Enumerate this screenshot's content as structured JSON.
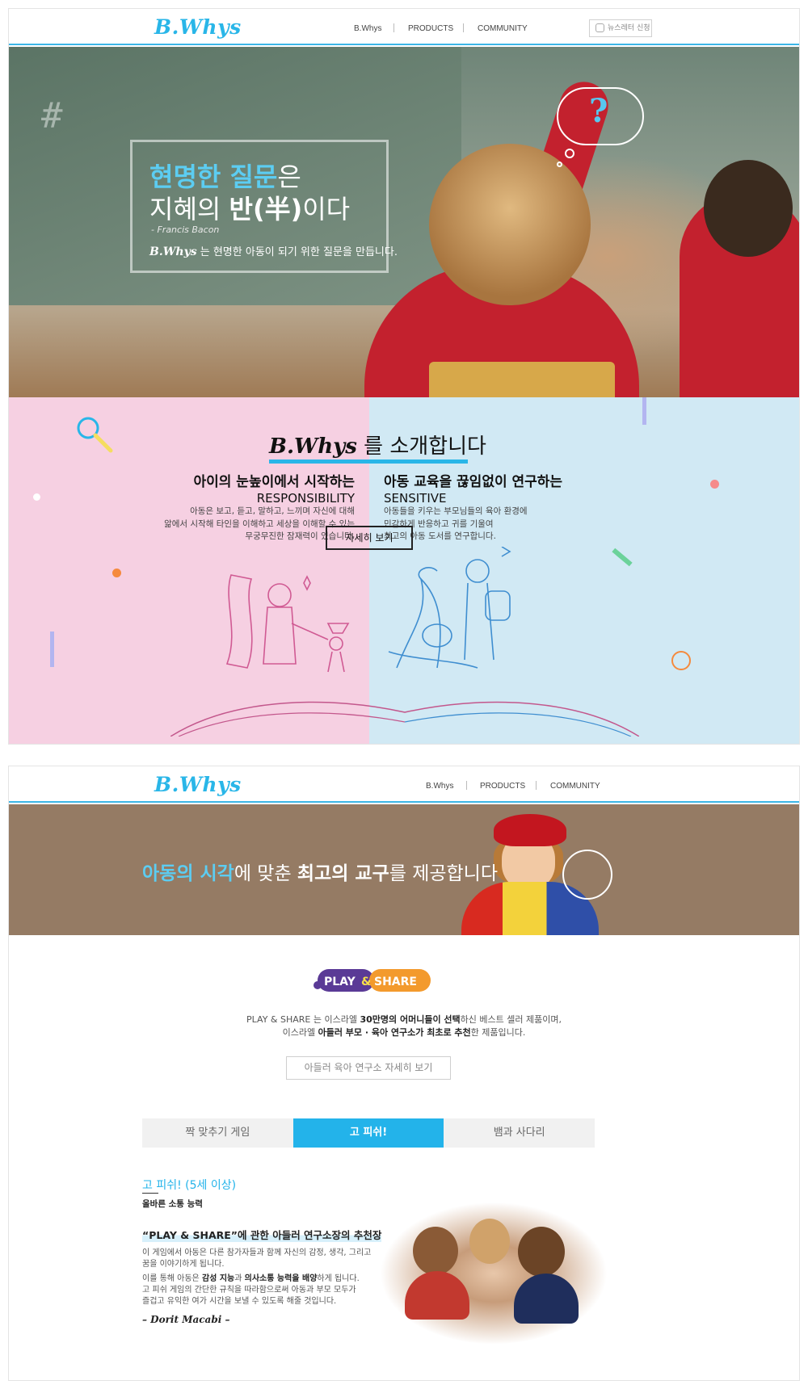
{
  "colors": {
    "accent": "#29b6e8",
    "pink_bg": "#f6d0e2",
    "blue_bg": "#d1e9f4",
    "tab_active": "#23b3ea",
    "hero2_bg": "#957b64"
  },
  "header1": {
    "logo": "B.Whys",
    "nav": [
      "B.Whys",
      "PRODUCTS",
      "COMMUNITY"
    ],
    "newsletter": "뉴스레터 신청",
    "newsletter_icon": "newsletter-icon"
  },
  "hero1": {
    "quote_hl": "현명한 질문",
    "quote_rest": "은",
    "quote2_pre": "지혜의 ",
    "quote2_b": "반(半)",
    "quote2_post": "이다",
    "author": "- Francis Bacon",
    "tagline_brand": "B.Whys",
    "tagline": " 는 현명한 아동이 되기 위한 질문을 만듭니다."
  },
  "intro": {
    "title_brand": "B.Whys",
    "title_rest": " 를 소개합니다",
    "left": {
      "heading": "아이의 눈높이에서 시작하는",
      "en": "RESPONSIBILITY",
      "lines": [
        "아동은 보고, 듣고, 말하고, 느끼며 자신에 대해",
        "앎에서 시작해 타인을 이해하고 세상을 이해할 수 있는",
        "무궁무진한 잠재력이 있습니다."
      ]
    },
    "right": {
      "heading": "아동 교육을 끊임없이 연구하는",
      "en": "SENSITIVE",
      "lines": [
        "아동들을 키우는 부모님들의 육아 환경에",
        "민감하게 반응하고 귀를 기울여",
        "최고의 아동 도서를 연구합니다."
      ]
    },
    "button": "자세히 보기"
  },
  "header2": {
    "logo": "B.Whys",
    "nav": [
      "B.Whys",
      "PRODUCTS",
      "COMMUNITY"
    ]
  },
  "hero2": {
    "hl": "아동의 시각",
    "t1": "에 맞춘 ",
    "b": "최고의 교구",
    "t2": "를 제공합니다"
  },
  "play_share": {
    "logo_play": "PLAY",
    "logo_amp": "&",
    "logo_share": "SHARE",
    "line1": [
      "PLAY & SHARE 는 이스라엘 ",
      "30만명의 어머니들이 선택",
      "하신 베스트 셀러 제품이며,"
    ],
    "line2": [
      "이스라엘 ",
      "아들러 부모 · 육아 연구소가 최초로 추천",
      "한 제품입니다."
    ],
    "button": "아들러 육아 연구소 자세히 보기"
  },
  "tabs": [
    {
      "label": "짝 맞추기 게임",
      "active": false
    },
    {
      "label": "고 피쉬!",
      "active": true
    },
    {
      "label": "뱀과 사다리",
      "active": false
    }
  ],
  "game": {
    "name": "고 피쉬! ",
    "age": "(5세 이상)",
    "skill": "올바른 소통 능력",
    "rec_title": "“PLAY & SHARE”에 관한 아들러 연구소장의 추천장",
    "p1": [
      "이 게임에서 아동은 다른 참가자들과 함께 자신의 감정, 생각, 그리고",
      "꿈을 이야기하게 됩니다."
    ],
    "p2a": [
      "이를 통해 아동은 ",
      "감성 지능",
      "과 ",
      "의사소통 능력을 배양",
      "하게 됩니다."
    ],
    "p2b": [
      "고 피쉬 게임의 간단한 규칙을 따라함으로써 아동과 부모 모두가",
      "즐겁고 유익한 여가 시간을 보낼 수 있도록 해줄 것입니다."
    ],
    "signature": "– Dorit Macabi –"
  }
}
